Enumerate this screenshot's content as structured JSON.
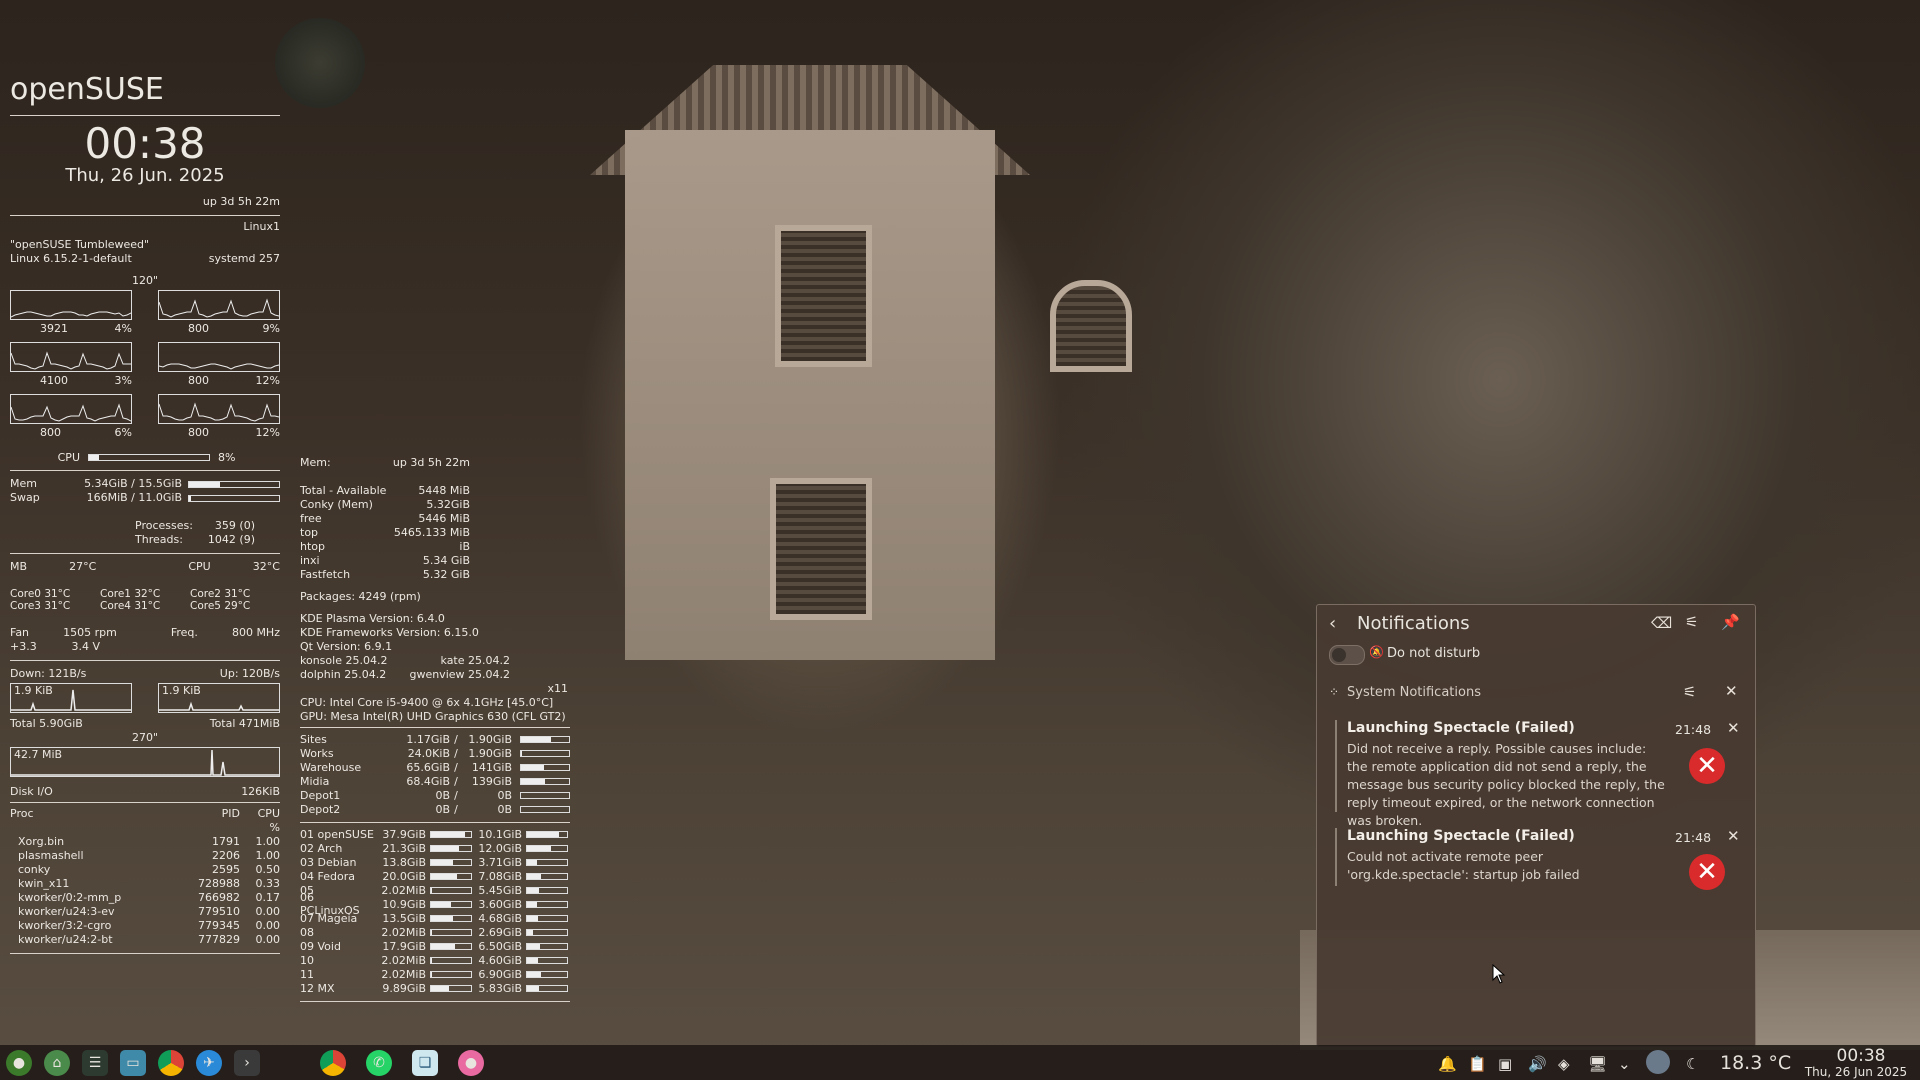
{
  "conky_left": {
    "title": "openSUSE",
    "time": "00:38",
    "date": "Thu, 26 Jun. 2025",
    "uptime": "up  3d 5h 22m",
    "hostname": "Linux1",
    "distro": "\"openSUSE Tumbleweed\"",
    "kernel": "Linux 6.15.2-1-default",
    "systemd": "systemd 257",
    "cpu_graph_period": "120\"",
    "cores": [
      {
        "freq": "3921",
        "pct": "4%"
      },
      {
        "freq": "800",
        "pct": "9%"
      },
      {
        "freq": "4100",
        "pct": "3%"
      },
      {
        "freq": "800",
        "pct": "12%"
      },
      {
        "freq": "800",
        "pct": "6%"
      },
      {
        "freq": "800",
        "pct": "12%"
      }
    ],
    "cpu_label": "CPU",
    "cpu_pct": "8%",
    "cpu_level": 0.08,
    "mem_label": "Mem",
    "mem_value": "5.34GiB / 15.5GiB",
    "mem_level": 0.34,
    "swap_label": "Swap",
    "swap_value": "166MiB / 11.0GiB",
    "swap_level": 0.01,
    "processes_label": "Processes:",
    "processes_value": "359 (0)",
    "threads_label": "Threads:",
    "threads_value": "1042 (9)",
    "mb_label": "MB",
    "mb_temp": "27°C",
    "cpu_temp_label": "CPU",
    "cpu_temp": "32°C",
    "core_temps": [
      "Core0  31°C",
      "Core1  32°C",
      "Core2  31°C",
      "Core3  31°C",
      "Core4  31°C",
      "Core5  29°C"
    ],
    "fan_label": "Fan",
    "fan_value": "1505 rpm",
    "freq_label": "Freq.",
    "freq_value": "800  MHz",
    "volt1": "+3.3",
    "volt2": "3.4  V",
    "down_label": "Down: 121B/s",
    "up_label": "Up: 120B/s",
    "down_graph_label": "1.9 KiB",
    "up_graph_label": "1.9 KiB",
    "total_down": "Total 5.90GiB",
    "total_up": "Total 471MiB",
    "disk_graph_period": "270\"",
    "disk_graph_label": "42.7 MiB",
    "diskio_label": "Disk I/O",
    "diskio_value": "126KiB",
    "proc_header": {
      "name": "Proc",
      "pid": "PID",
      "cpu": "CPU",
      "pct": "%"
    },
    "procs": [
      {
        "name": "Xorg.bin",
        "pid": "1791",
        "cpu": "1.00"
      },
      {
        "name": "plasmashell",
        "pid": "2206",
        "cpu": "1.00"
      },
      {
        "name": "conky",
        "pid": "2595",
        "cpu": "0.50"
      },
      {
        "name": "kwin_x11",
        "pid": "728988",
        "cpu": "0.33"
      },
      {
        "name": "kworker/0:2-mm_p",
        "pid": "766982",
        "cpu": "0.17"
      },
      {
        "name": "kworker/u24:3-ev",
        "pid": "779510",
        "cpu": "0.00"
      },
      {
        "name": "kworker/3:2-cgro",
        "pid": "779345",
        "cpu": "0.00"
      },
      {
        "name": "kworker/u24:2-bt",
        "pid": "777829",
        "cpu": "0.00"
      }
    ]
  },
  "conky_mid": {
    "mem_header": "Mem:",
    "uptime": "up  3d 5h 22m",
    "mem_rows": [
      {
        "name": "Total - Available",
        "value": "5448 MiB"
      },
      {
        "name": "Conky (Mem)",
        "value": "5.32GiB"
      },
      {
        "name": "free",
        "value": "5446   MiB"
      },
      {
        "name": "top",
        "value": "5465.133 MiB"
      },
      {
        "name": "htop",
        "value": "iB"
      },
      {
        "name": "inxi",
        "value": "5.34 GiB"
      },
      {
        "name": "Fastfetch",
        "value": "5.32 GiB"
      }
    ],
    "packages": "Packages: 4249 (rpm)",
    "plasma": "KDE Plasma Version: 6.4.0",
    "frameworks": "KDE Frameworks Version: 6.15.0",
    "qt": "Qt Version: 6.9.1",
    "konsole": "konsole 25.04.2",
    "kate": "kate 25.04.2",
    "dolphin": "dolphin 25.04.2",
    "gwenview": "gwenview 25.04.2",
    "session": "x11",
    "cpu": "CPU: Intel Core i5-9400 @ 6x 4.1GHz [45.0°C]",
    "gpu": "GPU: Mesa Intel(R) UHD Graphics 630 (CFL GT2)",
    "mounts": [
      {
        "name": "Sites",
        "used": "1.17GiB",
        "total": "1.90GiB",
        "level": 0.62
      },
      {
        "name": "Works",
        "used": "24.0KiB",
        "total": "1.90GiB",
        "level": 0.02
      },
      {
        "name": "Warehouse",
        "used": "65.6GiB",
        "total": "141GiB",
        "level": 0.47
      },
      {
        "name": "Midia",
        "used": "68.4GiB",
        "total": "139GiB",
        "level": 0.49
      },
      {
        "name": "Depot1",
        "used": "0B",
        "total": "0B",
        "level": 0
      },
      {
        "name": "Depot2",
        "used": "0B",
        "total": "0B",
        "level": 0
      }
    ],
    "partitions": [
      {
        "name": "01 openSUSE",
        "used": "37.9GiB",
        "u_level": 0.85,
        "free": "10.1GiB",
        "f_level": 0.8
      },
      {
        "name": "02 Arch",
        "used": "21.3GiB",
        "u_level": 0.7,
        "free": "12.0GiB",
        "f_level": 0.6
      },
      {
        "name": "03 Debian",
        "used": "13.8GiB",
        "u_level": 0.55,
        "free": "3.71GiB",
        "f_level": 0.25
      },
      {
        "name": "04 Fedora",
        "used": "20.0GiB",
        "u_level": 0.65,
        "free": "7.08GiB",
        "f_level": 0.35
      },
      {
        "name": "05",
        "used": "2.02MiB",
        "u_level": 0.02,
        "free": "5.45GiB",
        "f_level": 0.3
      },
      {
        "name": "06 PCLinuxOS",
        "used": "10.9GiB",
        "u_level": 0.5,
        "free": "3.60GiB",
        "f_level": 0.25
      },
      {
        "name": "07 Mageia",
        "used": "13.5GiB",
        "u_level": 0.55,
        "free": "4.68GiB",
        "f_level": 0.28
      },
      {
        "name": "08",
        "used": "2.02MiB",
        "u_level": 0.02,
        "free": "2.69GiB",
        "f_level": 0.15
      },
      {
        "name": "09 Void",
        "used": "17.9GiB",
        "u_level": 0.6,
        "free": "6.50GiB",
        "f_level": 0.33
      },
      {
        "name": "10",
        "used": "2.02MiB",
        "u_level": 0.02,
        "free": "4.60GiB",
        "f_level": 0.27
      },
      {
        "name": "11",
        "used": "2.02MiB",
        "u_level": 0.02,
        "free": "6.90GiB",
        "f_level": 0.35
      },
      {
        "name": "12 MX",
        "used": "9.89GiB",
        "u_level": 0.45,
        "free": "5.83GiB",
        "f_level": 0.3
      }
    ]
  },
  "notifications": {
    "title": "Notifications",
    "dnd_label": "Do not disturb",
    "group_title": "System Notifications",
    "items": [
      {
        "title": "Launching Spectacle (Failed)",
        "time": "21:48",
        "body": "Did not receive a reply. Possible causes include: the remote application did not send a reply, the message bus security policy blocked the reply, the reply timeout expired, or the network connection was broken."
      },
      {
        "title": "Launching Spectacle (Failed)",
        "time": "21:48",
        "body": "Could not activate remote peer 'org.kde.spectacle': startup job failed"
      }
    ]
  },
  "taskbar": {
    "temperature": "18.3 °C",
    "clock_time": "00:38",
    "clock_date": "Thu, 26 Jun 2025",
    "launchers": [
      "opensuse-icon",
      "home-icon",
      "terminal-icon",
      "files-icon",
      "chrome-icon",
      "browser-icon",
      "run-icon"
    ],
    "tasks": [
      "chrome-icon",
      "whatsapp-icon",
      "book-icon",
      "app-icon"
    ]
  },
  "colors": {
    "error": "#d92b2b",
    "panel": "#483a30",
    "chrome_red": "#db4437"
  }
}
